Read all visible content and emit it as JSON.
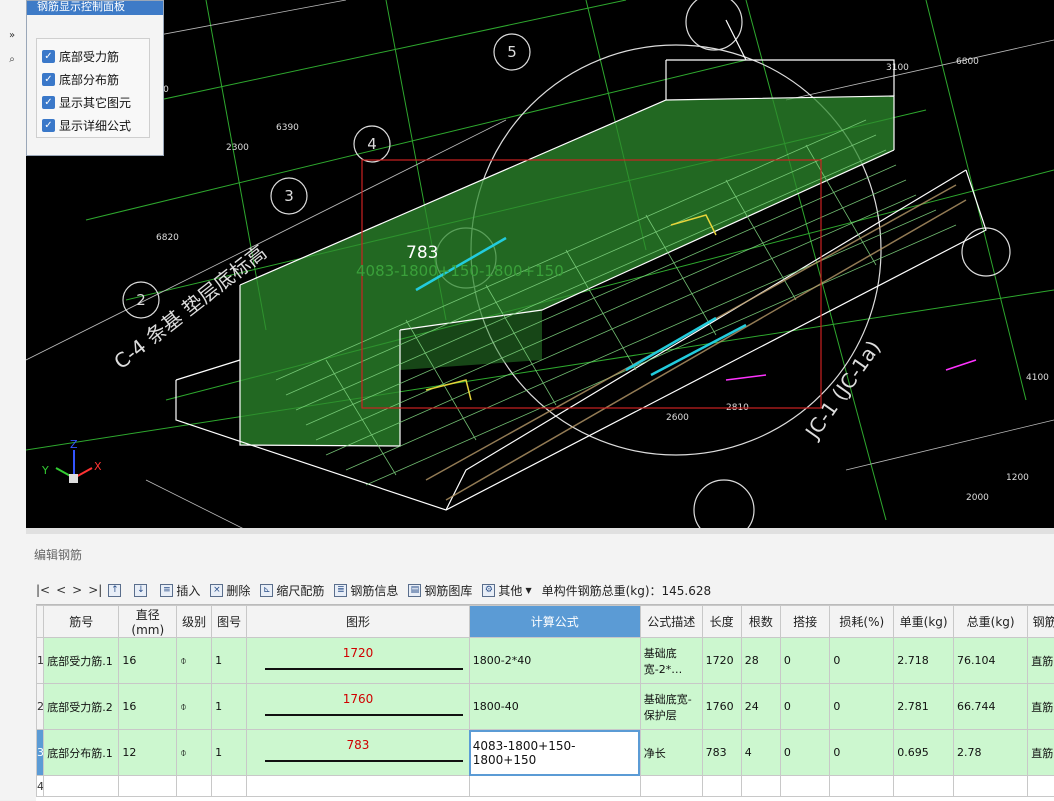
{
  "panel": {
    "title": "钢筋显示控制面板",
    "options": [
      {
        "label": "底部受力筋",
        "checked": true
      },
      {
        "label": "底部分布筋",
        "checked": true
      },
      {
        "label": "显示其它图元",
        "checked": true
      },
      {
        "label": "显示详细公式",
        "checked": true
      }
    ]
  },
  "viewport": {
    "axis_labels": [
      "5",
      "4",
      "3",
      "2"
    ],
    "section_label": "C-4 条基 垫层底标高",
    "measure_value": "783",
    "measure_formula": "4083-1800+150-1800+150",
    "right_label": "JC-1 (JC-1a)",
    "axis_gizmo": {
      "x": "X",
      "y": "Y",
      "z": "Z"
    },
    "colors": {
      "bg": "#000000",
      "green": "#2ea82e",
      "cyan": "#22ccdd",
      "yellow": "#e6d43a",
      "magenta": "#ff33ff",
      "red": "#cc2222"
    }
  },
  "editor": {
    "title": "编辑钢筋",
    "toolbar": {
      "nav": [
        "|<",
        "<",
        ">",
        ">|"
      ],
      "insert": "插入",
      "delete": "删除",
      "scale": "缩尺配筋",
      "info": "钢筋信息",
      "library": "钢筋图库",
      "other": "其他",
      "total_label": "单构件钢筋总重(kg)：145.628"
    },
    "columns": [
      "筋号",
      "直径(mm)",
      "级别",
      "图号",
      "图形",
      "计算公式",
      "公式描述",
      "长度",
      "根数",
      "搭接",
      "损耗(%)",
      "单重(kg)",
      "总重(kg)",
      "钢筋归类"
    ],
    "rows": [
      {
        "no": "1",
        "name": "底部受力筋.1",
        "dia": "16",
        "grade": "⌽",
        "fig": "1",
        "shape": "1720",
        "formula": "1800-2*40",
        "desc": "基础底宽-2*…",
        "len": "1720",
        "count": "28",
        "lap": "0",
        "loss": "0",
        "unit": "2.718",
        "total": "76.104",
        "cat": "直筋"
      },
      {
        "no": "2",
        "name": "底部受力筋.2",
        "dia": "16",
        "grade": "⌽",
        "fig": "1",
        "shape": "1760",
        "formula": "1800-40",
        "desc": "基础底宽-保护层",
        "len": "1760",
        "count": "24",
        "lap": "0",
        "loss": "0",
        "unit": "2.781",
        "total": "66.744",
        "cat": "直筋"
      },
      {
        "no": "3",
        "name": "底部分布筋.1",
        "dia": "12",
        "grade": "⌽",
        "fig": "1",
        "shape": "783",
        "formula": "4083-1800+150-1800+150",
        "desc": "净长",
        "len": "783",
        "count": "4",
        "lap": "0",
        "loss": "0",
        "unit": "0.695",
        "total": "2.78",
        "cat": "直筋"
      }
    ],
    "empty_row_no": "4"
  }
}
